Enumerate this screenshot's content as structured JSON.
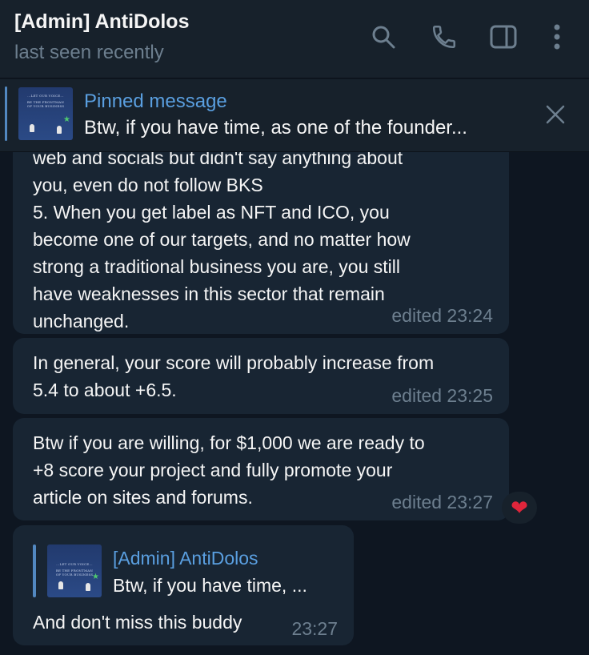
{
  "header": {
    "title": "[Admin] AntiDolos",
    "status": "last seen recently",
    "icons": [
      "search-icon",
      "phone-icon",
      "sidebar-toggle-icon",
      "more-vertical-icon"
    ]
  },
  "pinned": {
    "title": "Pinned message",
    "text": "Btw, if you have time, as one of the founder...",
    "thumbnail": {
      "line1": "...LET OUR VOICE...",
      "line2": "BE THE FRONTMAN",
      "line3": "OF YOUR BUSINESS"
    }
  },
  "messages": [
    {
      "lines": [
        "web and socials but didn't say anything about",
        "you,  even do not follow BKS",
        "5. When you get label as NFT and ICO, you",
        "become one of our targets, and no matter how",
        "strong a traditional business you are, you still",
        "have weaknesses in this sector that remain",
        "unchanged."
      ],
      "meta": "edited 23:24"
    },
    {
      "lines": [
        "In general, your score will probably increase from",
        "5.4 to about +6.5."
      ],
      "meta": "edited 23:25"
    },
    {
      "lines": [
        "Btw if you are willing, for $1,000 we are ready to",
        "+8 score your project and fully promote your",
        "article on sites and forums."
      ],
      "meta": "edited 23:27",
      "reaction": "❤"
    },
    {
      "reply": {
        "name": "[Admin] AntiDolos",
        "text": "Btw, if you have time, ..."
      },
      "text": "And don't miss this buddy",
      "meta": "23:27"
    }
  ],
  "colors": {
    "background": "#0e1621",
    "header": "#17212b",
    "bubble": "#182533",
    "accent": "#5a9fe0",
    "muted": "#6d7f8f",
    "heart": "#e0253b"
  }
}
